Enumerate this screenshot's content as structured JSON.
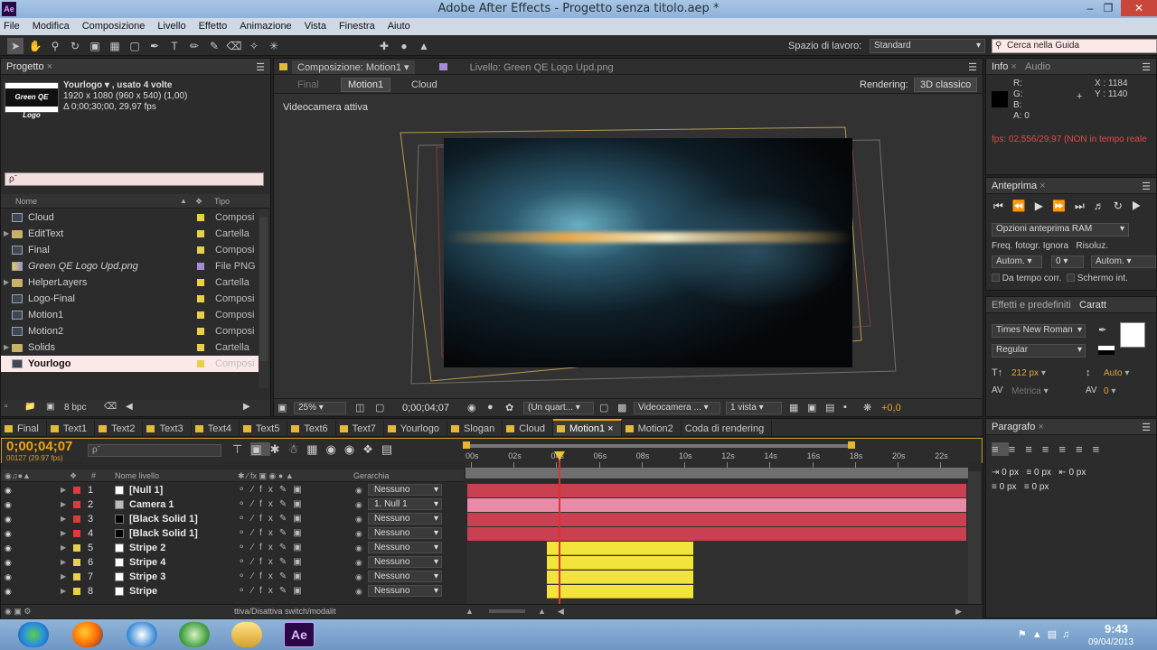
{
  "window": {
    "title": "Adobe After Effects - Progetto senza titolo.aep *",
    "app_icon": "Ae"
  },
  "menu": [
    "File",
    "Modifica",
    "Composizione",
    "Livello",
    "Effetto",
    "Animazione",
    "Vista",
    "Finestra",
    "Aiuto"
  ],
  "toolbar": {
    "workspace_label": "Spazio di lavoro:",
    "workspace_value": "Standard",
    "help_placeholder": "Cerca nella Guida"
  },
  "project": {
    "tab": "Progetto",
    "thumb_text": "Green QE Logo",
    "info_name": "Yourlogo ▾ , usato 4 volte",
    "info_size": "1920 x 1080  (960 x 540) (1,00)",
    "info_duration": "Δ 0;00;30;00, 29,97 fps",
    "search_placeholder": "ρˉ",
    "col_name": "Nome",
    "col_type": "Tipo",
    "items": [
      {
        "name": "Cloud",
        "type": "Composi",
        "kind": "comp",
        "color": "#e8d04a"
      },
      {
        "name": "EditText",
        "type": "Cartella",
        "kind": "folder",
        "color": "#e8d04a"
      },
      {
        "name": "Final",
        "type": "Composi",
        "kind": "comp",
        "color": "#e8d04a"
      },
      {
        "name": "Green QE Logo Upd.png",
        "type": "File PNG",
        "kind": "png",
        "color": "#a58bd6"
      },
      {
        "name": "HelperLayers",
        "type": "Cartella",
        "kind": "folder",
        "color": "#e8d04a"
      },
      {
        "name": "Logo-Final",
        "type": "Composi",
        "kind": "comp",
        "color": "#e8d04a"
      },
      {
        "name": "Motion1",
        "type": "Composi",
        "kind": "comp",
        "color": "#e8d04a"
      },
      {
        "name": "Motion2",
        "type": "Composi",
        "kind": "comp",
        "color": "#e8d04a"
      },
      {
        "name": "Solids",
        "type": "Cartella",
        "kind": "folder",
        "color": "#e8d04a"
      },
      {
        "name": "Yourlogo",
        "type": "Composi",
        "kind": "comp",
        "color": "#e8d04a"
      }
    ],
    "bpc": "8 bpc"
  },
  "composition": {
    "tab": "Composizione: Motion1",
    "layer_tab": "Livello: Green QE Logo Upd.png",
    "breadcrumbs": [
      "Final",
      "Motion1",
      "Cloud"
    ],
    "renderer_label": "Rendering:",
    "renderer_value": "3D classico",
    "camera_label": "Videocamera attiva",
    "zoom": "25%",
    "timecode": "0;00;04;07",
    "resolution": "(Un quart...",
    "view": "Videocamera ...",
    "views_count": "1 vista",
    "exposure": "+0,0"
  },
  "info": {
    "tabs": [
      "Info",
      "Audio"
    ],
    "r": "R:",
    "g": "G:",
    "b": "B:",
    "a": "A:  0",
    "x": "X : 1184",
    "y": "Y : 1140",
    "fps": "fps: 02,556/29,97 (NON in tempo reale"
  },
  "preview": {
    "tab": "Anteprima",
    "ram_options": "Opzioni anteprima RAM",
    "frame_rate": "Freq. fotogr.",
    "skip": "Ignora",
    "resolution": "Risoluz.",
    "frame_val": "Autom.",
    "skip_val": "0",
    "res_val": "Autom.",
    "from_current": "Da tempo corr.",
    "fullscreen": "Schermo int."
  },
  "character": {
    "tabs": [
      "Effetti e predefiniti",
      "Caratt"
    ],
    "font": "Times New Roman",
    "style": "Regular",
    "size": "212 px",
    "leading": "Auto",
    "tracking_label": "Metrica",
    "tracking": "0"
  },
  "paragraph": {
    "tab": "Paragrafo",
    "indent_left": "0 px",
    "indent_first": "0 px",
    "indent_right": "0 px",
    "space_before": "0 px",
    "space_after": "0 px"
  },
  "timeline": {
    "tabs": [
      "Final",
      "Text1",
      "Text2",
      "Text3",
      "Text4",
      "Text5",
      "Text6",
      "Text7",
      "Yourlogo",
      "Slogan",
      "Cloud",
      "Motion1",
      "Motion2",
      "Coda di rendering"
    ],
    "active_tab": "Motion1",
    "timecode": "0;00;04;07",
    "frame_info": "00127 (29.97 fps)",
    "col_layer_name": "Nome livello",
    "col_parent": "Gerarchia",
    "ruler": [
      "00s",
      "02s",
      "04s",
      "06s",
      "08s",
      "10s",
      "12s",
      "14s",
      "16s",
      "18s",
      "20s",
      "22s"
    ],
    "layers": [
      {
        "num": "1",
        "name": "[Null 1]",
        "parent": "Nessuno",
        "color": "#e03b3b",
        "src_color": "#ffffff"
      },
      {
        "num": "2",
        "name": "Camera 1",
        "parent": "1. Null 1",
        "color": "#e03b3b",
        "src_color": "#bbbbbb"
      },
      {
        "num": "3",
        "name": "[Black Solid 1]",
        "parent": "Nessuno",
        "color": "#e03b3b",
        "src_color": "#000000"
      },
      {
        "num": "4",
        "name": "[Black Solid 1]",
        "parent": "Nessuno",
        "color": "#e03b3b",
        "src_color": "#000000"
      },
      {
        "num": "5",
        "name": "Stripe 2",
        "parent": "Nessuno",
        "color": "#e8d04a",
        "src_color": "#ffffff"
      },
      {
        "num": "6",
        "name": "Stripe 4",
        "parent": "Nessuno",
        "color": "#e8d04a",
        "src_color": "#ffffff"
      },
      {
        "num": "7",
        "name": "Stripe 3",
        "parent": "Nessuno",
        "color": "#e8d04a",
        "src_color": "#ffffff"
      },
      {
        "num": "8",
        "name": "Stripe",
        "parent": "Nessuno",
        "color": "#e8d04a",
        "src_color": "#ffffff"
      }
    ],
    "status_tip": "ttiva/Disattiva switch/modalit"
  },
  "taskbar": {
    "time": "9:43",
    "date": "09/04/2013"
  },
  "colors": {
    "accent_orange": "#f0a500",
    "layer_red": "#c94050",
    "layer_yellow": "#f2e43a",
    "playhead": "#e03030"
  }
}
